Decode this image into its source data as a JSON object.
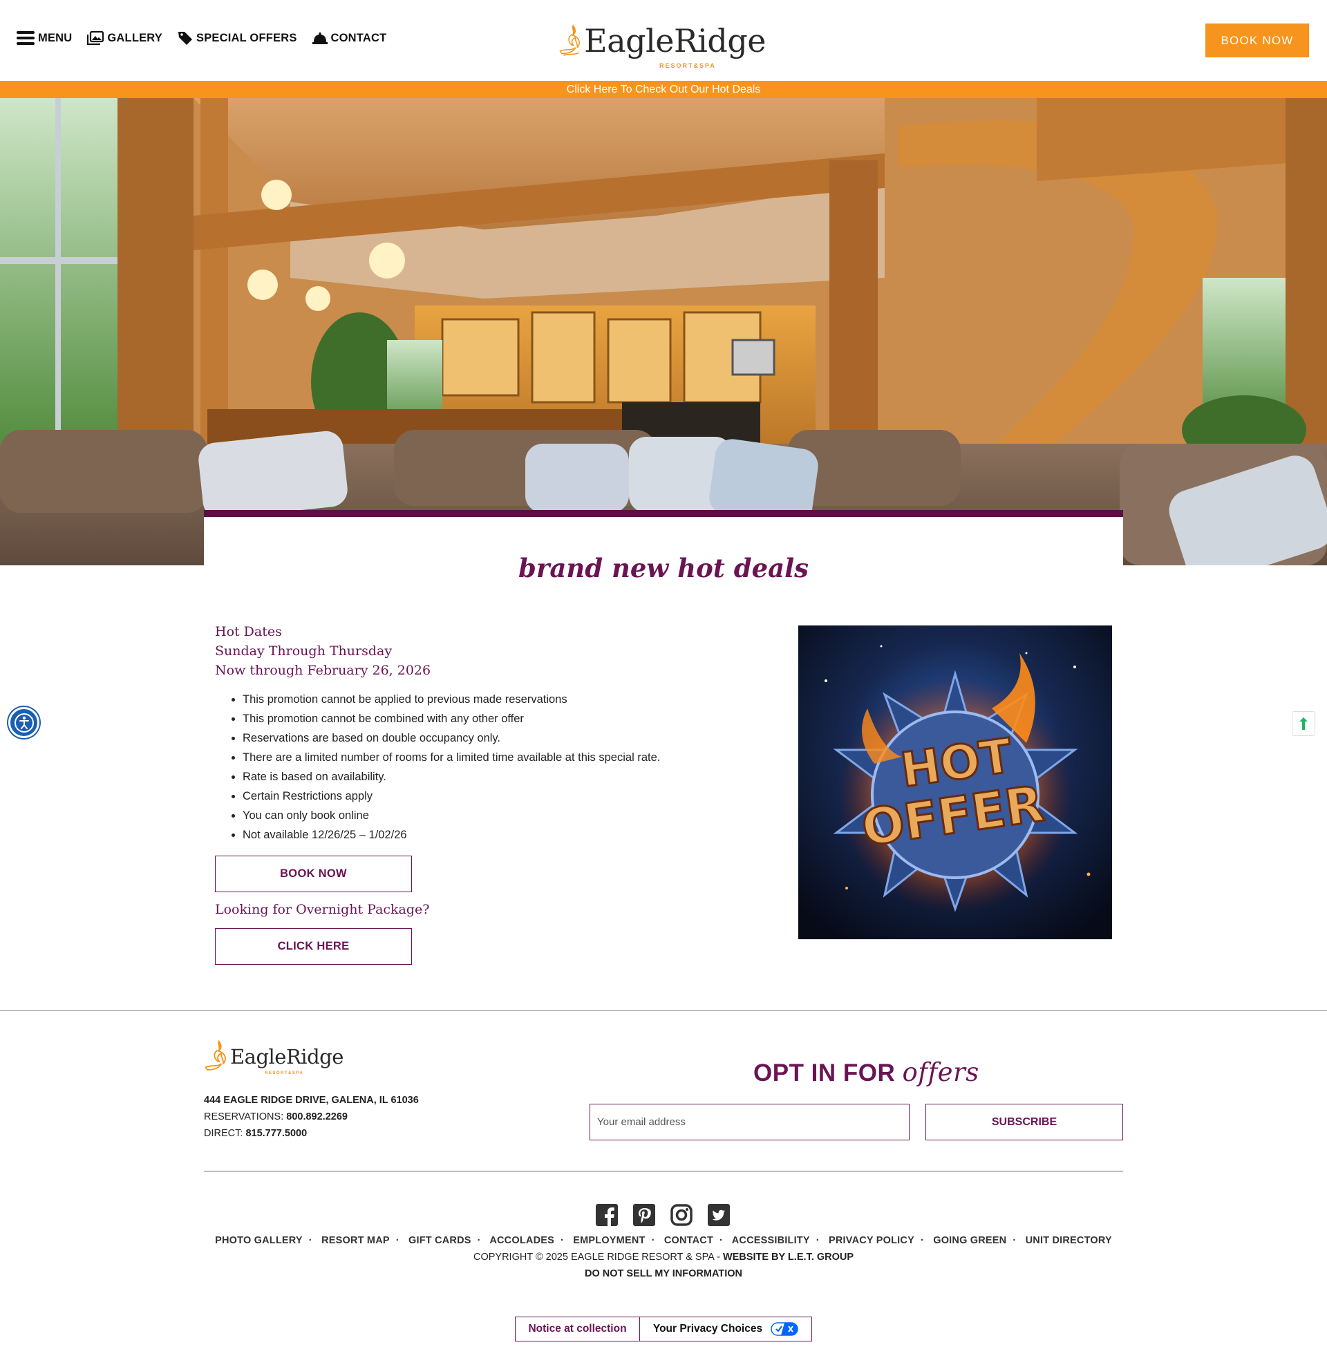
{
  "header": {
    "nav": [
      {
        "label": "MENU",
        "icon": "hamburger-icon"
      },
      {
        "label": "GALLERY",
        "icon": "gallery-icon"
      },
      {
        "label": "SPECIAL OFFERS",
        "icon": "tag-icon"
      },
      {
        "label": "CONTACT",
        "icon": "bell-icon"
      }
    ],
    "logo": {
      "name": "EagleRidge",
      "sub": "RESORT&SPA"
    },
    "book_now": "BOOK NOW"
  },
  "hot_bar": "Click Here To Check Out Our Hot Deals",
  "section_title": "brand new hot deals",
  "deal": {
    "lines": [
      "Hot Dates",
      "Sunday Through Thursday",
      "Now through February 26, 2026"
    ],
    "bullets": [
      "This promotion cannot be applied to previous made reservations",
      "This promotion cannot be combined with any other offer",
      "Reservations are based on double occupancy only.",
      "There are a limited number of rooms for a limited time available at this special rate.",
      "Rate is based on availability.",
      "Certain Restrictions apply",
      "You can only book online",
      "Not available 12/26/25 – 1/02/26"
    ],
    "book_button": "BOOK NOW",
    "package_text": "Looking for Overnight Package?",
    "click_button": "CLICK HERE",
    "image_text": [
      "HOT",
      "OFFER"
    ]
  },
  "footer": {
    "logo": {
      "name": "EagleRidge",
      "sub": "RESORT&SPA"
    },
    "address": "444 EAGLE RIDGE DRIVE, GALENA, IL 61036",
    "reservations_label": "RESERVATIONS:",
    "reservations_phone": "800.892.2269",
    "direct_label": "DIRECT:",
    "direct_phone": "815.777.5000",
    "optin_a": "OPT IN FOR",
    "optin_b": "offers",
    "email_placeholder": "Your email address",
    "subscribe": "SUBSCRIBE",
    "socials": [
      "facebook-icon",
      "pinterest-icon",
      "instagram-icon",
      "twitter-icon"
    ],
    "links": [
      "PHOTO GALLERY",
      "RESORT MAP",
      "GIFT CARDS",
      "ACCOLADES",
      "EMPLOYMENT",
      "CONTACT",
      "ACCESSIBILITY",
      "PRIVACY POLICY",
      "GOING GREEN",
      "UNIT DIRECTORY"
    ],
    "copyright": "COPYRIGHT © 2025 EAGLE RIDGE RESORT & SPA -",
    "website_by": "WEBSITE BY L.E.T. GROUP",
    "do_not_sell": "DO NOT SELL MY INFORMATION"
  },
  "privacy": {
    "notice": "Notice at collection",
    "choices": "Your Privacy Choices"
  },
  "colors": {
    "orange": "#f7941d",
    "plum": "#6b1454",
    "band": "#5a0f46"
  }
}
